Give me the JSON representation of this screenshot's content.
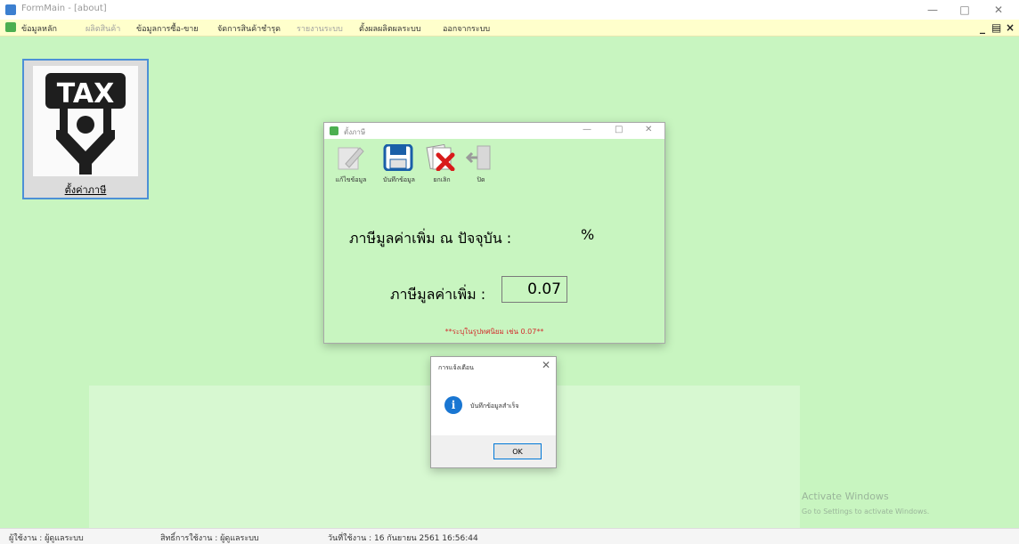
{
  "window": {
    "title": "FormMain - [about]"
  },
  "menu": {
    "items": [
      {
        "label": "ข้อมูลหลัก",
        "dim": false
      },
      {
        "label": "ผลิตสินค้า",
        "dim": true
      },
      {
        "label": "ข้อมูลการซื้อ-ขาย",
        "dim": false
      },
      {
        "label": "จัดการสินค้าชำรุด",
        "dim": false
      },
      {
        "label": "รายงานระบบ",
        "dim": true
      },
      {
        "label": "ตั้งผลผลิตผลระบบ",
        "dim": false
      },
      {
        "label": "ออกจากระบบ",
        "dim": false
      }
    ]
  },
  "tile": {
    "icon_text": "TAX",
    "label": "ตั้งค่าภาษี"
  },
  "dialog": {
    "title": "ตั้งภาษี",
    "toolbar": [
      {
        "label": "แก้ไขข้อมูล",
        "icon": "edit-icon"
      },
      {
        "label": "บันทึกข้อมูล",
        "icon": "save-icon"
      },
      {
        "label": "ยกเลิก",
        "icon": "cancel-icon"
      },
      {
        "label": "ปิด",
        "icon": "exit-icon"
      }
    ],
    "current_vat_label": "ภาษีมูลค่าเพิ่ม ณ ปัจจุบัน :",
    "percent_symbol": "%",
    "vat_label": "ภาษีมูลค่าเพิ่ม :",
    "vat_value": "0.07",
    "hint": "**ระบุในรูปทศนิยม เช่น 0.07**"
  },
  "message": {
    "title": "การแจ้งเตือน",
    "text": "บันทึกข้อมูลสำเร็จ",
    "ok_label": "OK"
  },
  "watermark": {
    "line1": "Activate Windows",
    "line2": "Go to Settings to activate Windows."
  },
  "status": {
    "user": "ผู้ใช้งาน : ผู้ดูแลระบบ",
    "role": "สิทธิ์การใช้งาน : ผู้ดูแลระบบ",
    "date": "วันที่ใช้งาน : 16 กันยายน 2561 16:56:44"
  },
  "colors": {
    "background": "#c8f5c0",
    "menubar": "#ffffcc",
    "hint": "#d32f2f",
    "info": "#1976d2"
  }
}
